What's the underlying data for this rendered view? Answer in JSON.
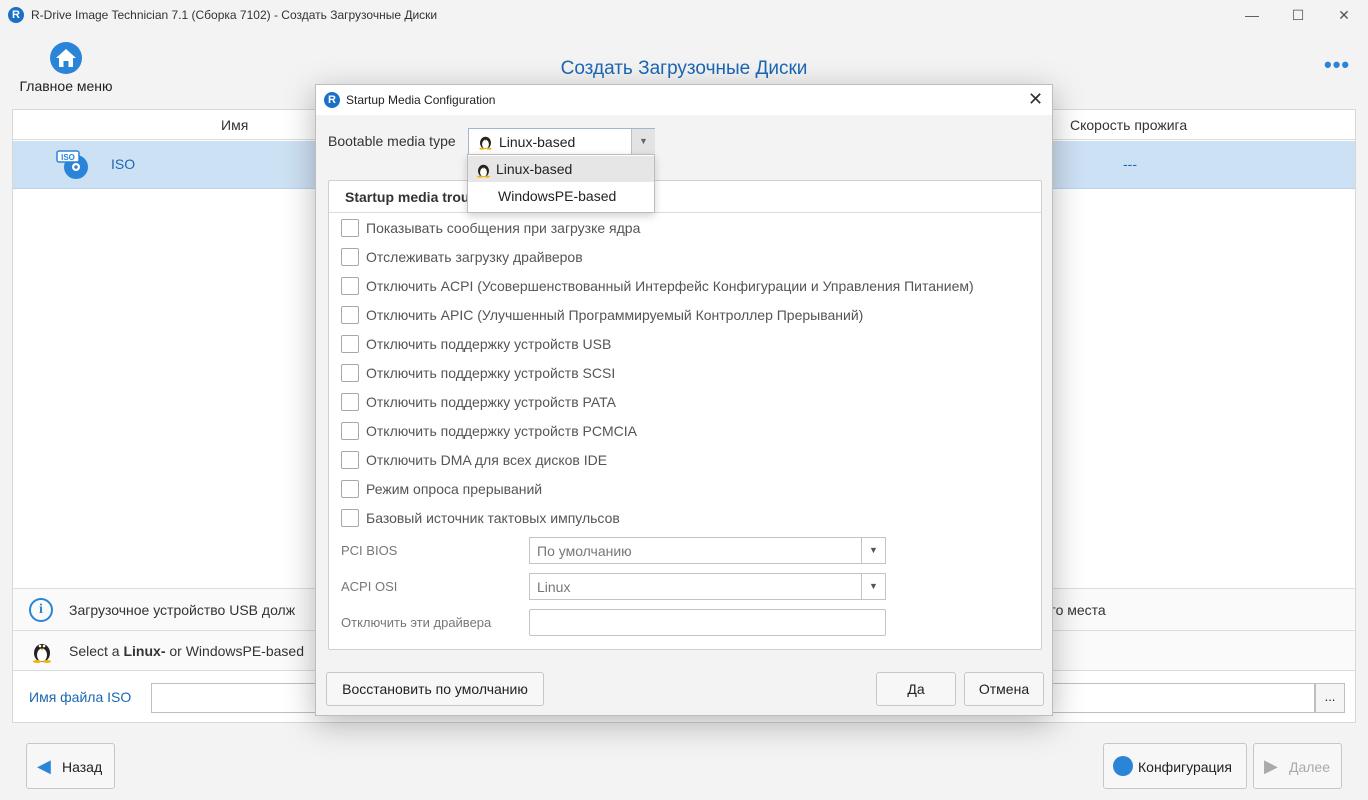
{
  "window": {
    "title": "R-Drive Image Technician 7.1 (Сборка 7102) - Создать Загрузочные Диски",
    "logo_letter": "R",
    "minimize": "—",
    "maximize": "☐",
    "close": "✕"
  },
  "header": {
    "home_label": "Главное меню",
    "page_title": "Создать Загрузочные Диски",
    "more_icon": "•••"
  },
  "table": {
    "columns": [
      "Имя",
      "Скорость прожига"
    ],
    "rows": [
      {
        "name": "ISO",
        "speed": "---",
        "icon": "iso-disc-icon"
      }
    ]
  },
  "info": {
    "usb_text": "Загрузочное устройство USB долж",
    "usb_text_end": "ого места",
    "linux_prefix": "Select a ",
    "linux_bold": "Linux-",
    "linux_rest": " or WindowsPE-based"
  },
  "iso_file": {
    "label": "Имя файла ISO",
    "value": "",
    "browse": "..."
  },
  "footer": {
    "back": "Назад",
    "config": "Конфигурация",
    "next": "Далее"
  },
  "dialog": {
    "title": "Startup Media Configuration",
    "logo_letter": "R",
    "close": "✕",
    "type_label": "Bootable media type",
    "type_value": "Linux-based",
    "type_options": [
      "Linux-based",
      "WindowsPE-based"
    ],
    "group_title": "Startup media trou",
    "checkboxes": [
      "Показывать сообщения при загрузке ядра",
      "Отслеживать загрузку драйверов",
      "Отключить ACPI (Усовершенствованный Интерфейс Конфигурации и Управления Питанием)",
      "Отключить APIC (Улучшенный Программируемый Контроллер Прерываний)",
      "Отключить поддержку устройств USB",
      "Отключить поддержку устройств SCSI",
      "Отключить поддержку устройств PATA",
      "Отключить поддержку устройств PCMCIA",
      "Отключить DMA для всех дисков IDE",
      "Режим опроса прерываний",
      "Базовый источник тактовых импульсов"
    ],
    "pci_bios_label": "PCI BIOS",
    "pci_bios_value": "По умолчанию",
    "acpi_osi_label": "ACPI OSI",
    "acpi_osi_value": "Linux",
    "drivers_label": "Отключить эти драйвера",
    "drivers_value": "",
    "restore": "Восстановить по умолчанию",
    "ok": "Да",
    "cancel": "Отмена"
  }
}
